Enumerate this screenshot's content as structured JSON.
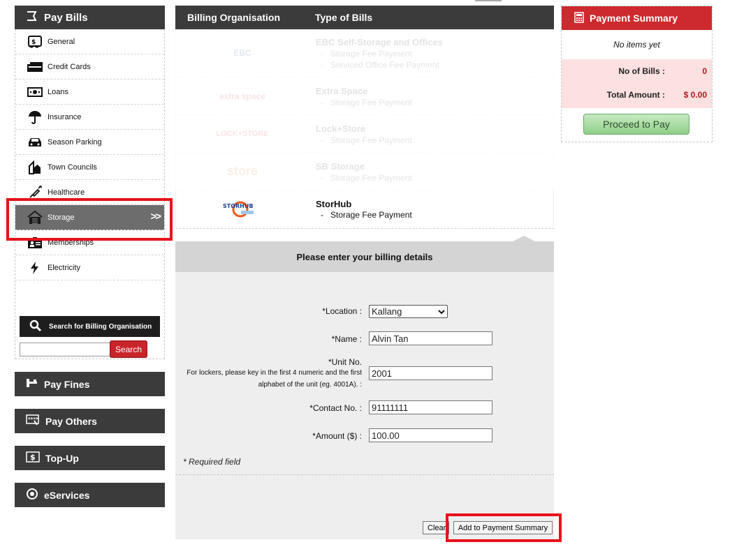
{
  "sidebar": {
    "title": "Pay Bills",
    "items": [
      {
        "label": "General",
        "icon": "bill-icon"
      },
      {
        "label": "Credit Cards",
        "icon": "credit-card-icon"
      },
      {
        "label": "Loans",
        "icon": "money-icon"
      },
      {
        "label": "Insurance",
        "icon": "umbrella-icon"
      },
      {
        "label": "Season Parking",
        "icon": "car-icon"
      },
      {
        "label": "Town Councils",
        "icon": "building-icon"
      },
      {
        "label": "Healthcare",
        "icon": "syringe-icon"
      },
      {
        "label": "Storage",
        "icon": "house-icon",
        "active": true
      },
      {
        "label": "Memberships",
        "icon": "id-card-icon"
      },
      {
        "label": "Electricity",
        "icon": "lightning-icon"
      }
    ],
    "search": {
      "label": "Search for Billing Organisation",
      "placeholder": "",
      "button": "Search"
    },
    "blocks": [
      {
        "label": "Pay Fines"
      },
      {
        "label": "Pay Others"
      },
      {
        "label": "Top-Up"
      },
      {
        "label": "eServices"
      }
    ]
  },
  "table": {
    "col1": "Billing Organisation",
    "col2": "Type of Bills",
    "orgs": [
      {
        "logo": "EBC",
        "name": "EBC Self-Storage and Offices",
        "types": [
          "Storage Fee Payment",
          "Serviced Office Fee Payment"
        ]
      },
      {
        "logo": "extra space",
        "name": "Extra Space",
        "types": [
          "Storage Fee Payment"
        ]
      },
      {
        "logo": "LOCK+STORE",
        "name": "Lock+Store",
        "types": [
          "Storage Fee Payment"
        ]
      },
      {
        "logo": "store",
        "name": "SB Storage",
        "types": [
          "Storage Fee Payment"
        ]
      },
      {
        "logo": "STORHUB",
        "name": "StorHub",
        "types": [
          "Storage Fee Payment"
        ]
      }
    ]
  },
  "form": {
    "title": "Please enter your billing details",
    "location_label": "*Location :",
    "location_value": "Kallang",
    "name_label": "*Name :",
    "name_value": "Alvin Tan",
    "unit_label": "*Unit No.",
    "unit_note": "For lockers, please key in the first 4 numeric and the first alphabet of the unit (eg. 4001A). :",
    "unit_value": "2001",
    "contact_label": "*Contact No. :",
    "contact_value": "91111111",
    "amount_label": "*Amount ($) :",
    "amount_value": "100.00",
    "required_note": "* Required field",
    "clear_button": "Clear",
    "add_button": "Add to Payment Summary"
  },
  "summary": {
    "title": "Payment Summary",
    "empty": "No items yet",
    "bills_label": "No of Bills :",
    "bills_value": "0",
    "total_label": "Total Amount :",
    "total_value": "$ 0.00",
    "proceed": "Proceed to Pay"
  },
  "colors": {
    "header_dark": "#3b3b3b",
    "accent_red": "#cc2a2e",
    "highlight": "#e8121a",
    "summary_bg": "#fde0e0"
  }
}
